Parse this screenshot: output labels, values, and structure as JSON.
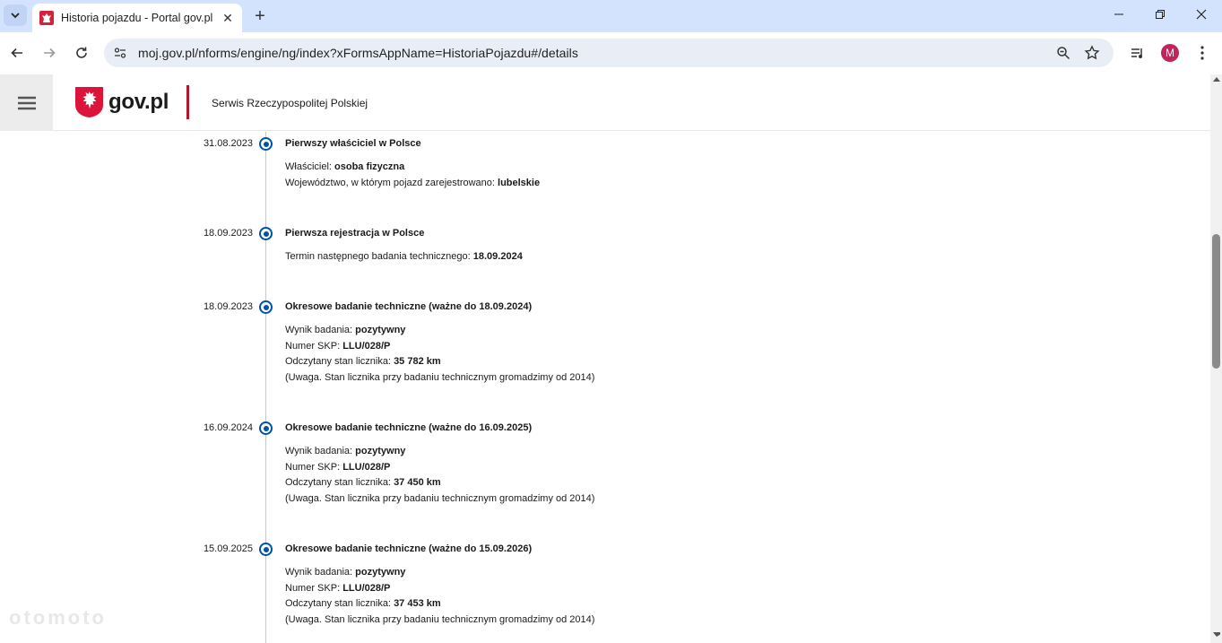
{
  "browser": {
    "tab_title": "Historia pojazdu - Portal gov.pl",
    "url": "moj.gov.pl/nforms/engine/ng/index?xFormsAppName=HistoriaPojazdu#/details",
    "profile_initial": "M"
  },
  "header": {
    "brand": "gov.pl",
    "service_name": "Serwis Rzeczypospolitej Polskiej"
  },
  "timeline": [
    {
      "date": "31.08.2023",
      "title": "Pierwszy właściciel w Polsce",
      "rows": [
        {
          "label": "Właściciel: ",
          "value": "osoba fizyczna"
        },
        {
          "label": "Województwo, w którym pojazd zarejestrowano: ",
          "value": "lubelskie"
        }
      ]
    },
    {
      "date": "18.09.2023",
      "title": "Pierwsza rejestracja w Polsce",
      "rows": [
        {
          "label": "Termin następnego badania technicznego: ",
          "value": "18.09.2024"
        }
      ]
    },
    {
      "date": "18.09.2023",
      "title": "Okresowe badanie techniczne (ważne do 18.09.2024)",
      "rows": [
        {
          "label": "Wynik badania: ",
          "value": "pozytywny"
        },
        {
          "label": "Numer SKP: ",
          "value": "LLU/028/P"
        },
        {
          "label": "Odczytany stan licznika: ",
          "value": "35 782 km"
        },
        {
          "label": "(Uwaga. Stan licznika przy badaniu technicznym gromadzimy od 2014)",
          "value": ""
        }
      ]
    },
    {
      "date": "16.09.2024",
      "title": "Okresowe badanie techniczne (ważne do 16.09.2025)",
      "rows": [
        {
          "label": "Wynik badania: ",
          "value": "pozytywny"
        },
        {
          "label": "Numer SKP: ",
          "value": "LLU/028/P"
        },
        {
          "label": "Odczytany stan licznika: ",
          "value": "37 450 km"
        },
        {
          "label": "(Uwaga. Stan licznika przy badaniu technicznym gromadzimy od 2014)",
          "value": ""
        }
      ]
    },
    {
      "date": "15.09.2025",
      "title": "Okresowe badanie techniczne (ważne do 15.09.2026)",
      "rows": [
        {
          "label": "Wynik badania: ",
          "value": "pozytywny"
        },
        {
          "label": "Numer SKP: ",
          "value": "LLU/028/P"
        },
        {
          "label": "Odczytany stan licznika: ",
          "value": "37 453 km"
        },
        {
          "label": "(Uwaga. Stan licznika przy badaniu technicznym gromadzimy od 2014)",
          "value": ""
        }
      ]
    }
  ],
  "watermark": "otomoto",
  "colors": {
    "accent_blue": "#0052a5",
    "gov_red": "#b4152d",
    "tabstrip": "#d3e3fd"
  }
}
